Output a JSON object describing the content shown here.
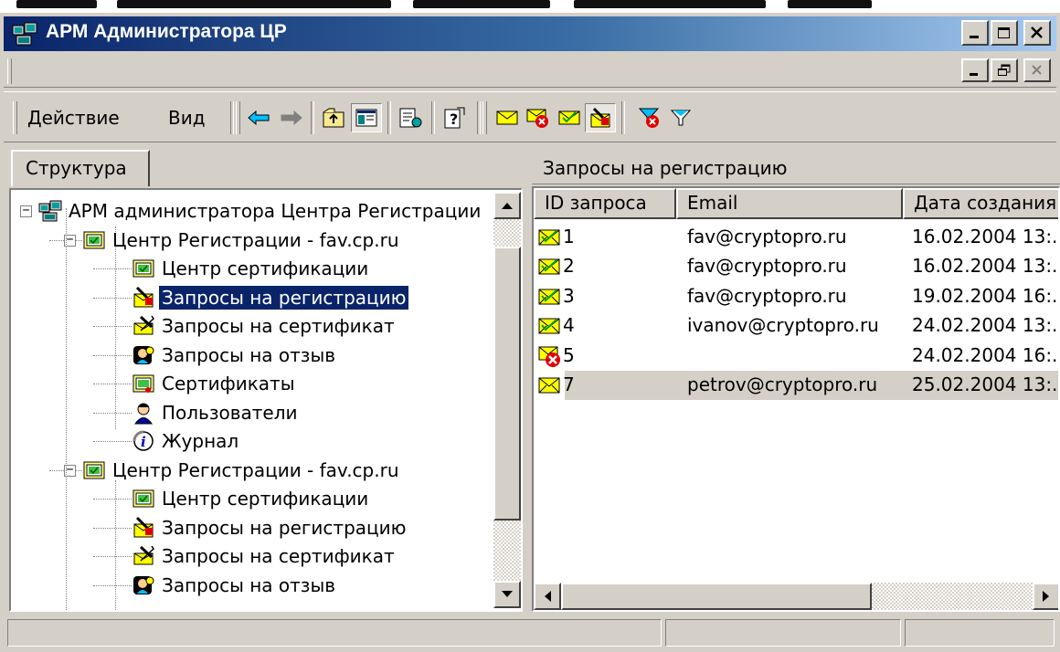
{
  "window": {
    "title": "АРМ Администратора ЦР"
  },
  "toolbar": {
    "menu_action": "Действие",
    "menu_view": "Вид"
  },
  "left_pane": {
    "tab_label": "Структура",
    "tree": [
      {
        "label": "АРМ администратора Центра Регистрации",
        "icon": "admin-workstation-icon",
        "level": 0,
        "expander": "−"
      },
      {
        "label": "Центр Регистрации - fav.cp.ru",
        "icon": "registration-center-icon",
        "level": 1,
        "expander": "−"
      },
      {
        "label": "Центр сертификации",
        "icon": "certification-center-icon",
        "level": 2
      },
      {
        "label": "Запросы на регистрацию",
        "icon": "registration-requests-icon",
        "level": 2,
        "selected": true
      },
      {
        "label": "Запросы на сертификат",
        "icon": "certificate-requests-icon",
        "level": 2
      },
      {
        "label": "Запросы на отзыв",
        "icon": "revocation-requests-icon",
        "level": 2
      },
      {
        "label": "Сертификаты",
        "icon": "certificates-icon",
        "level": 2
      },
      {
        "label": "Пользователи",
        "icon": "users-icon",
        "level": 2
      },
      {
        "label": "Журнал",
        "icon": "journal-icon",
        "level": 2
      },
      {
        "label": "Центр Регистрации - fav.cp.ru",
        "icon": "registration-center-icon",
        "level": 1,
        "expander": "−"
      },
      {
        "label": "Центр сертификации",
        "icon": "certification-center-icon",
        "level": 2
      },
      {
        "label": "Запросы на регистрацию",
        "icon": "registration-requests-icon",
        "level": 2
      },
      {
        "label": "Запросы на сертификат",
        "icon": "certificate-requests-icon",
        "level": 2
      },
      {
        "label": "Запросы на отзыв",
        "icon": "revocation-requests-icon",
        "level": 2
      }
    ]
  },
  "right_pane": {
    "header": "Запросы на регистрацию",
    "columns": [
      "ID запроса",
      "Email",
      "Дата создания"
    ],
    "rows": [
      {
        "id": "1",
        "email": "fav@cryptopro.ru",
        "date": "16.02.2004 13:.",
        "icon": "envelope-ok-icon"
      },
      {
        "id": "2",
        "email": "fav@cryptopro.ru",
        "date": "16.02.2004 13:.",
        "icon": "envelope-ok-icon"
      },
      {
        "id": "3",
        "email": "fav@cryptopro.ru",
        "date": "19.02.2004 16:.",
        "icon": "envelope-ok-icon"
      },
      {
        "id": "4",
        "email": "ivanov@cryptopro.ru",
        "date": "24.02.2004 13:.",
        "icon": "envelope-ok-icon"
      },
      {
        "id": "5",
        "email": "",
        "date": "24.02.2004 16:.",
        "icon": "envelope-rejected-icon"
      },
      {
        "id": "7",
        "email": "petrov@cryptopro.ru",
        "date": "25.02.2004 13:.",
        "icon": "envelope-icon",
        "highlighted": true
      }
    ]
  },
  "colors": {
    "title_start": "#0a246a",
    "title_end": "#a6caf0",
    "face": "#d4d0c8",
    "selection": "#0a246a"
  }
}
